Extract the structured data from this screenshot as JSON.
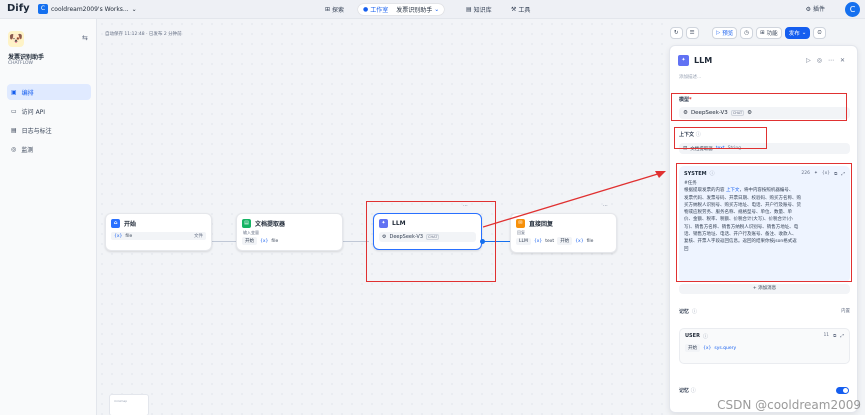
{
  "topbar": {
    "logo": "Dify",
    "workspace_badge": "C",
    "workspace": "cooldream2009's Works...",
    "nav_explore": "探索",
    "nav_studio": "工作室",
    "nav_app": "发票识别助手",
    "nav_knowledge": "知识库",
    "nav_tools": "工具",
    "plugin": "插件",
    "avatar": "C"
  },
  "sidebar": {
    "app_name": "发票识别助手",
    "app_type": "CHATFLOW",
    "items": [
      {
        "label": "编排",
        "icon": "orchestrate-icon"
      },
      {
        "label": "访问 API",
        "icon": "api-icon"
      },
      {
        "label": "日志与标注",
        "icon": "logs-icon"
      },
      {
        "label": "监测",
        "icon": "monitor-icon"
      }
    ]
  },
  "canvas": {
    "autosave": "自动保存 11:12:48 · 已发布 2 分钟前",
    "nodes": {
      "start": {
        "title": "开始",
        "var": "file",
        "var_prefix": "{x}",
        "var_type": "文件"
      },
      "extractor": {
        "title": "文档提取器",
        "sub": "输入变量",
        "ref_node": "开始",
        "ref_var": "file",
        "var_prefix": "{x}"
      },
      "llm": {
        "title": "LLM",
        "model": "DeepSeek-V3",
        "model_tag": "CHAT"
      },
      "answer": {
        "title": "直接回复",
        "sub": "回复",
        "ref_node1": "LLM",
        "ref_var1": "text",
        "ref_node2": "开始",
        "ref_var2": "file",
        "var_prefix": "{x}"
      }
    },
    "minimap_text": "minimap"
  },
  "toolbar": {
    "preview": "预览",
    "features": "功能",
    "publish": "发布"
  },
  "panel": {
    "title": "LLM",
    "desc_placeholder": "添加描述...",
    "model_label": "模型",
    "model_required": "*",
    "model_name": "DeepSeek-V3",
    "model_tag": "CHAT",
    "context_label": "上下文",
    "context_node": "文档提取器",
    "context_var": "text",
    "context_type": "String",
    "system_label": "SYSTEM",
    "token_count": "226",
    "system_lines": [
      "#任务",
      "根据提取发票的内容",
      "上下文",
      "，将中内容按照机器编号、",
      "发票代码、发票号码、开票日期、校验码、购买方名称、购",
      "买方纳税人识别号、购买方地址、电话、开户行及账号、货",
      "物或应税劳务、服务名称、规格型号、单位、数量、单",
      "价、金额、税率、税额、价税合计(大写)、价税合计(小",
      "写)、销售方名称、销售方纳税人识别号、销售方地址、电",
      "话、销售方地址、电话、开户行及账号、备注、收款人、",
      "复核、开票人字段返回信息。返回的结果你按json格式返",
      "回"
    ],
    "add_message": "添加消息",
    "memory_label": "记忆",
    "memory_value": "内置",
    "user_label": "USER",
    "user_count": "11",
    "user_ref_node": "开始",
    "user_ref_var": "sys.query",
    "memory_toggle_label": "记忆"
  },
  "watermark": "CSDN @cooldream2009"
}
